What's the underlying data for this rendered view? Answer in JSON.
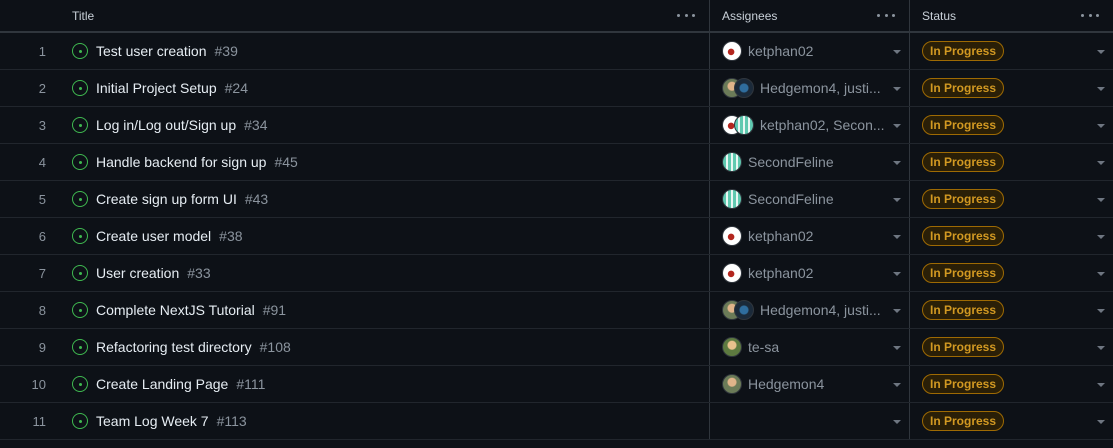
{
  "header": {
    "title": "Title",
    "assignees": "Assignees",
    "status": "Status"
  },
  "rows": [
    {
      "num": "1",
      "title": "Test user creation",
      "issue": "#39",
      "avatars": [
        "ketphan"
      ],
      "assignees": "ketphan02",
      "status": "In Progress"
    },
    {
      "num": "2",
      "title": "Initial Project Setup",
      "issue": "#24",
      "avatars": [
        "hedge",
        "justi"
      ],
      "assignees": "Hedgemon4, justi...",
      "status": "In Progress"
    },
    {
      "num": "3",
      "title": "Log in/Log out/Sign up",
      "issue": "#34",
      "avatars": [
        "ketphan",
        "second"
      ],
      "assignees": "ketphan02, Secon...",
      "status": "In Progress"
    },
    {
      "num": "4",
      "title": "Handle backend for sign up",
      "issue": "#45",
      "avatars": [
        "second"
      ],
      "assignees": "SecondFeline",
      "status": "In Progress"
    },
    {
      "num": "5",
      "title": "Create sign up form UI",
      "issue": "#43",
      "avatars": [
        "second"
      ],
      "assignees": "SecondFeline",
      "status": "In Progress"
    },
    {
      "num": "6",
      "title": "Create user model",
      "issue": "#38",
      "avatars": [
        "ketphan"
      ],
      "assignees": "ketphan02",
      "status": "In Progress"
    },
    {
      "num": "7",
      "title": "User creation",
      "issue": "#33",
      "avatars": [
        "ketphan"
      ],
      "assignees": "ketphan02",
      "status": "In Progress"
    },
    {
      "num": "8",
      "title": "Complete NextJS Tutorial",
      "issue": "#91",
      "avatars": [
        "hedge",
        "justi"
      ],
      "assignees": "Hedgemon4, justi...",
      "status": "In Progress"
    },
    {
      "num": "9",
      "title": "Refactoring test directory",
      "issue": "#108",
      "avatars": [
        "tesa"
      ],
      "assignees": "te-sa",
      "status": "In Progress"
    },
    {
      "num": "10",
      "title": "Create Landing Page",
      "issue": "#111",
      "avatars": [
        "hedge"
      ],
      "assignees": "Hedgemon4",
      "status": "In Progress"
    },
    {
      "num": "11",
      "title": "Team Log Week 7",
      "issue": "#113",
      "avatars": [],
      "assignees": "",
      "status": "In Progress"
    }
  ]
}
